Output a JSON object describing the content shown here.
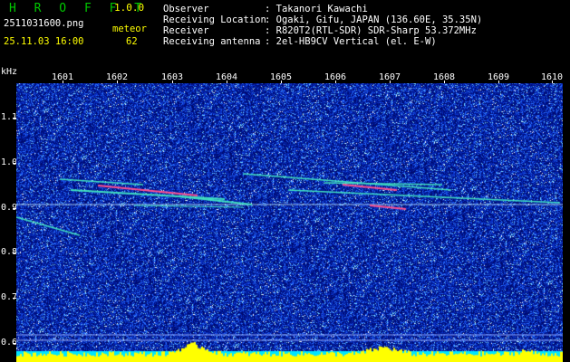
{
  "header": {
    "app_name": "H R O F F T",
    "version": "1.0.0",
    "filename": "2511031600.png",
    "datetime": "25.11.03 16:00",
    "meteor_label": "meteor",
    "meteor_count": "62",
    "info": [
      {
        "label": "Observer",
        "value": ": Takanori Kawachi"
      },
      {
        "label": "Receiving Location",
        "value": ": Ogaki, Gifu, JAPAN (136.60E, 35.35N)"
      },
      {
        "label": "Receiver",
        "value": ": R820T2(RTL-SDR) SDR-Sharp 53.372MHz"
      },
      {
        "label": "Receiving antenna",
        "value": ": 2el-HB9CV Vertical (el. E-W)"
      }
    ]
  },
  "spectrogram": {
    "y_unit": "kHz",
    "x_ticks": [
      "1601",
      "1602",
      "1603",
      "1604",
      "1605",
      "1606",
      "1607",
      "1608",
      "1609",
      "1610"
    ],
    "y_ticks": [
      "1.1",
      "1.0",
      "0.9",
      "0.8",
      "0.7",
      "0.6"
    ],
    "colors": {
      "background": "#000000",
      "noise_low": "#001a8c",
      "noise_high": "#2a6cff",
      "trail": "#40e0c0",
      "trail_hot": "#ff4080",
      "level_bars": "#ffff00",
      "level_base": "#00ffff"
    }
  }
}
